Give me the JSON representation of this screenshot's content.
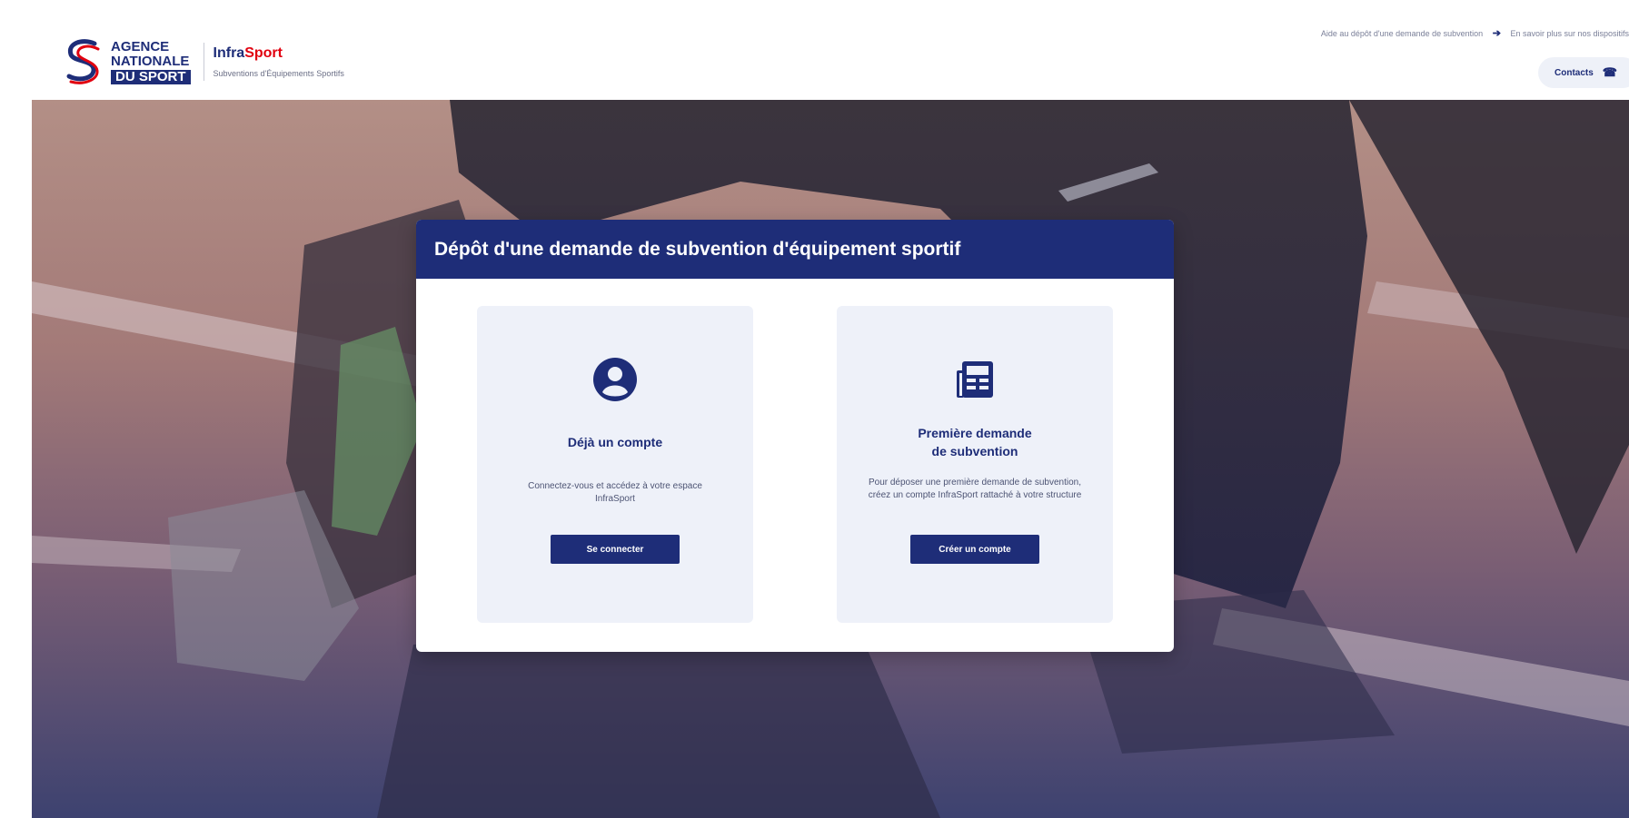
{
  "header": {
    "logo": {
      "line1": "AGENCE",
      "line2": "NATIONALE",
      "line3": "DU SPORT"
    },
    "app_name_part1": "Infra",
    "app_name_part2": "Sport",
    "app_subtitle": "Subventions d'Équipements Sportifs",
    "link_help": "Aide au dépôt d'une demande de subvention",
    "link_more": "En savoir plus sur nos dispositifs",
    "contacts_label": "Contacts",
    "colors": {
      "primary": "#1e2d78",
      "accent": "#e1000f"
    }
  },
  "card": {
    "title": "Dépôt d'une demande de subvention d'équipement sportif",
    "left": {
      "icon": "user-circle-icon",
      "title": "Déjà un compte",
      "description": "Connectez-vous et accédez à votre espace InfraSport",
      "button": "Se connecter"
    },
    "right": {
      "icon": "newspaper-icon",
      "title_line1": "Première demande",
      "title_line2": "de subvention",
      "description": "Pour déposer une première demande de subvention, créez un compte InfraSport rattaché à votre structure",
      "button": "Créer un compte"
    }
  }
}
